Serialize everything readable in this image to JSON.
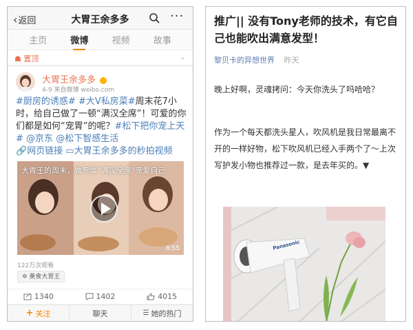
{
  "left": {
    "nav": {
      "back_label": "返回",
      "title": "大胃王余多多"
    },
    "tabs": [
      "主页",
      "微博",
      "视频",
      "故事"
    ],
    "active_tab": "微博",
    "pinned_label": "置顶",
    "post": {
      "username": "大胃王余多多",
      "meta": "4-9  来自微博 weibo.com",
      "text_parts": [
        {
          "t": "#厨房的诱惑#",
          "hl": true
        },
        {
          "t": " ",
          "hl": false
        },
        {
          "t": "#大V私房菜#",
          "hl": true
        },
        {
          "t": "周末花7小时，给自己做了一顿“满汉全席”！可爱的你们都是如何“宠胃”的呢？",
          "hl": false
        },
        {
          "t": "#松下把你宠上天#",
          "hl": true
        },
        {
          "t": " ",
          "hl": false
        },
        {
          "t": "@京东",
          "hl": true
        },
        {
          "t": " ",
          "hl": false
        },
        {
          "t": "@松下智感生活",
          "hl": true
        }
      ],
      "links": {
        "web_link": "网页链接",
        "video_link": "大胃王余多多的秒拍视频"
      },
      "video": {
        "caption": "大胃王的周末，做专属“满汉全席”宠爱自己",
        "duration": "8:55"
      },
      "views": "122万次观看",
      "tag": "美食大胃王"
    },
    "stats": {
      "reposts": "1340",
      "comments": "1402",
      "likes": "4015"
    },
    "actions": {
      "follow": "关注",
      "chat": "聊天",
      "hot": "她的热门"
    },
    "colors": {
      "accent": "#ff8200",
      "username": "#eb7350",
      "link": "#4b7fb8"
    }
  },
  "right": {
    "title": "推广|| 没有Tony老师的技术，有它自己也能吹出满意发型！",
    "author": "黎贝卡的异想世界",
    "time": "昨天",
    "paragraphs": [
      "晚上好啊，灵魂拷问：今天你洗头了吗哈哈？",
      "作为一个每天都洗头星人，吹风机是我日常最离不开的一样好物，松下吹风机已经入手两个了～上次写护发小物也推荐过一款，是去年买的。▼"
    ],
    "image_brand": "Panasonic"
  }
}
